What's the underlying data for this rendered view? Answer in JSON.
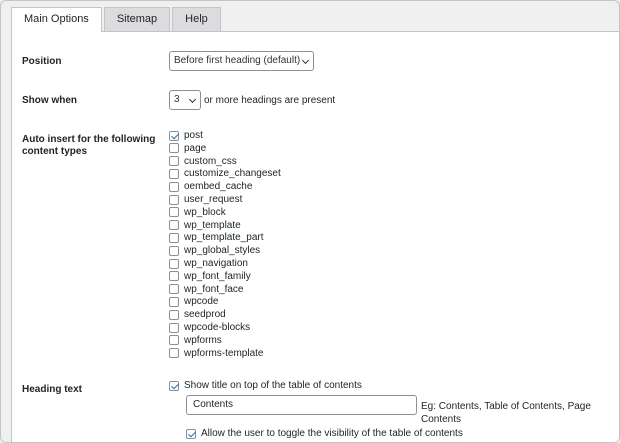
{
  "tabs": [
    {
      "label": "Main Options",
      "active": true
    },
    {
      "label": "Sitemap",
      "active": false
    },
    {
      "label": "Help",
      "active": false
    }
  ],
  "position": {
    "label": "Position",
    "value": "Before first heading (default)"
  },
  "show_when": {
    "label": "Show when",
    "value": "3",
    "suffix": "or more headings are present"
  },
  "auto_insert": {
    "label_line1": "Auto insert for the following",
    "label_line2": "content types",
    "items": [
      {
        "label": "post",
        "checked": true
      },
      {
        "label": "page",
        "checked": false
      },
      {
        "label": "custom_css",
        "checked": false
      },
      {
        "label": "customize_changeset",
        "checked": false
      },
      {
        "label": "oembed_cache",
        "checked": false
      },
      {
        "label": "user_request",
        "checked": false
      },
      {
        "label": "wp_block",
        "checked": false
      },
      {
        "label": "wp_template",
        "checked": false
      },
      {
        "label": "wp_template_part",
        "checked": false
      },
      {
        "label": "wp_global_styles",
        "checked": false
      },
      {
        "label": "wp_navigation",
        "checked": false
      },
      {
        "label": "wp_font_family",
        "checked": false
      },
      {
        "label": "wp_font_face",
        "checked": false
      },
      {
        "label": "wpcode",
        "checked": false
      },
      {
        "label": "seedprod",
        "checked": false
      },
      {
        "label": "wpcode-blocks",
        "checked": false
      },
      {
        "label": "wpforms",
        "checked": false
      },
      {
        "label": "wpforms-template",
        "checked": false
      }
    ]
  },
  "heading_text": {
    "label": "Heading text",
    "show_title_label": "Show title on top of the table of contents",
    "show_title_checked": true,
    "input_value": "Contents",
    "hint": "Eg: Contents, Table of Contents, Page Contents",
    "toggle_label": "Allow the user to toggle the visibility of the table of contents",
    "toggle_checked": true
  },
  "colors": {
    "accent": "#2271b1",
    "border": "#c3c4c7",
    "background": "#f0f0f1"
  }
}
